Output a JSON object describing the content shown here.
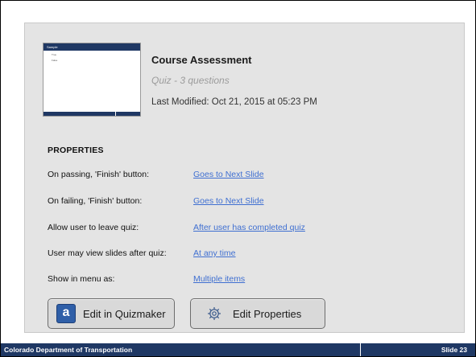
{
  "quiz": {
    "title": "Course Assessment",
    "subtitle": "Quiz - 3 questions",
    "modified": "Last Modified: Oct 21, 2015 at 05:23 PM"
  },
  "properties": {
    "heading": "PROPERTIES",
    "rows": [
      {
        "label": "On passing, 'Finish' button:",
        "value": "Goes to Next Slide"
      },
      {
        "label": "On failing, 'Finish' button:",
        "value": "Goes to Next Slide"
      },
      {
        "label": "Allow user to leave quiz:",
        "value": "After user has completed quiz"
      },
      {
        "label": "User may view slides after quiz:",
        "value": "At any time"
      },
      {
        "label": "Show in menu as:",
        "value": "Multiple items"
      }
    ]
  },
  "buttons": {
    "quizmaker": "Edit in Quizmaker",
    "properties": "Edit Properties",
    "quizmaker_icon": "a"
  },
  "thumbnail": {
    "heading": "Sample",
    "options": [
      "True",
      "False"
    ]
  },
  "footer": {
    "left": "Colorado Department of Transportation",
    "right": "Slide 23"
  },
  "colors": {
    "footer_bg": "#1f3864",
    "link": "#3f6fd1",
    "panel_bg": "#e4e4e4"
  }
}
